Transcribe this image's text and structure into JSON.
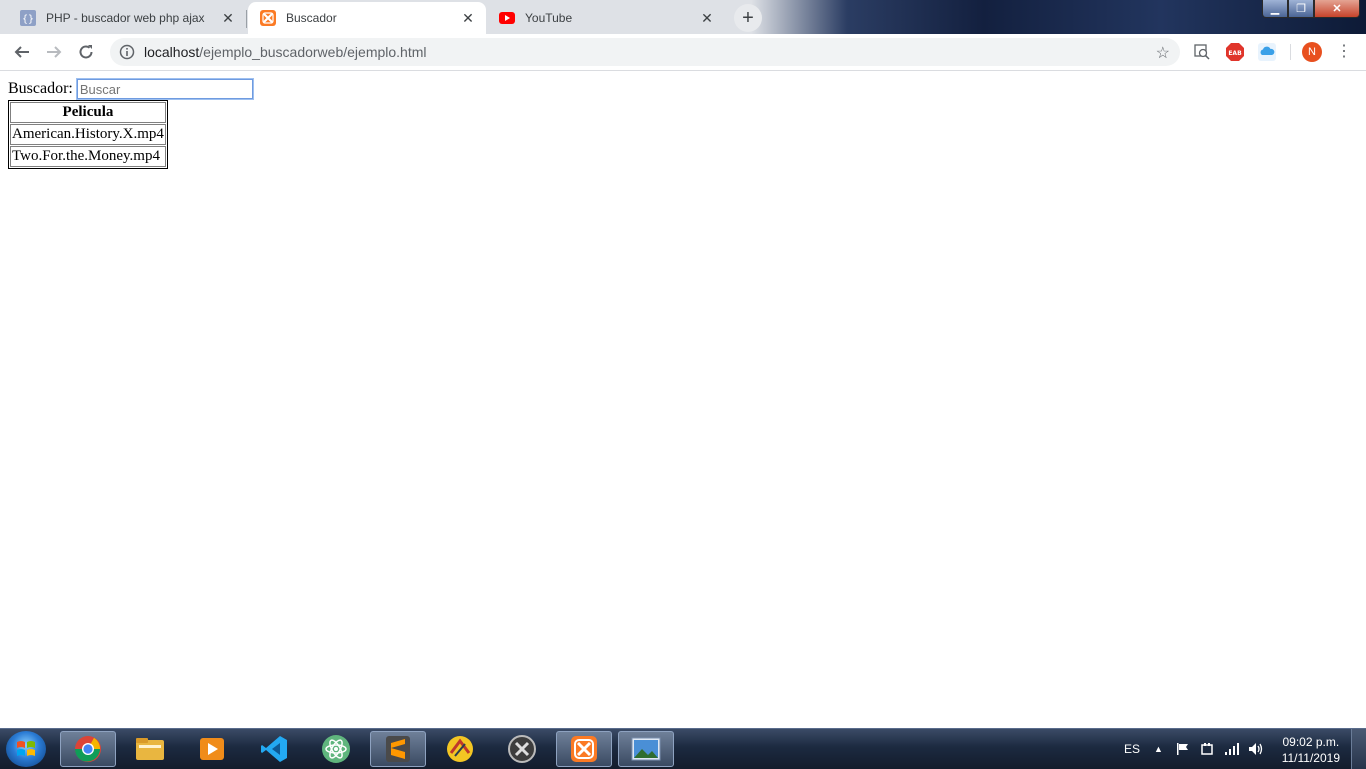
{
  "browser": {
    "tabs": [
      {
        "title": "PHP - buscador web php ajax",
        "close": "✕",
        "active": false,
        "icon": "brackets-icon"
      },
      {
        "title": "Buscador",
        "close": "✕",
        "active": true,
        "icon": "xampp-icon"
      },
      {
        "title": "YouTube",
        "close": "✕",
        "active": false,
        "icon": "youtube-icon"
      }
    ],
    "new_tab": "+",
    "window_controls": {
      "minimize": "▁",
      "maximize": "❐",
      "close": "✕"
    },
    "address": {
      "host": "localhost",
      "path": "/ejemplo_buscadorweb/ejemplo.html"
    },
    "profile_initial": "N",
    "extension_badge": "EAB",
    "colors": {
      "accent": "#1a73e8",
      "avatar": "#e8501f",
      "youtube": "#ff0000",
      "xampp": "#fb7a24"
    }
  },
  "page": {
    "search_label": "Buscador:",
    "search_placeholder": "Buscar",
    "table": {
      "header": "Pelicula",
      "rows": [
        "American.History.X.mp4",
        "Two.For.the.Money.mp4"
      ]
    }
  },
  "taskbar": {
    "apps": [
      "chrome-icon",
      "explorer-icon",
      "media-player-icon",
      "vscode-icon",
      "atom-icon",
      "sublime-icon",
      "filezilla-icon",
      "sync-icon",
      "xampp-icon",
      "photos-icon"
    ],
    "language": "ES",
    "tray_arrow": "▲",
    "time": "09:02 p.m.",
    "date": "11/11/2019"
  }
}
